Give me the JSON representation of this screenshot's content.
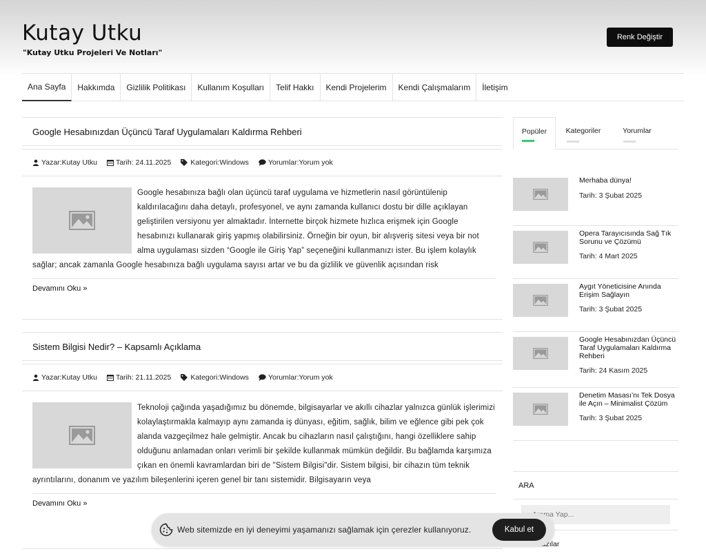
{
  "site": {
    "title": "Kutay Utku",
    "tagline": "\"Kutay Utku Projeleri Ve Notları\"",
    "color_button": "Renk Değiştir"
  },
  "nav": [
    "Ana Sayfa",
    "Hakkımda",
    "Gizlilik Politikası",
    "Kullanım Koşulları",
    "Telif Hakkı",
    "Kendi Projelerim",
    "Kendi Çalışmalarım",
    "İletişim"
  ],
  "posts": [
    {
      "title": "Google Hesabınızdan Üçüncü Taraf Uygulamaları Kaldırma Rehberi",
      "author": "Yazar:Kutay Utku",
      "date": "Tarih: 24.11.2025",
      "category": "Kategori:Windows",
      "comments": "Yorumlar:Yorum yok",
      "excerpt": "Google hesabınıza bağlı olan üçüncü taraf uygulama ve hizmetlerin nasıl görüntülenip kaldırılacağını daha detaylı, profesyonel, ve aynı zamanda kullanıcı dostu bir dille açıklayan geliştirilen versiyonu yer almaktadır. İnternette birçok hizmete hızlıca erişmek için Google hesabınızı kullanarak giriş yapmış olabilirsiniz. Örneğin bir oyun, bir alışveriş sitesi veya bir not alma uygulaması sizden “Google ile Giriş Yap” seçeneğini kullanmanızı ister. Bu işlem kolaylık sağlar; ancak zamanla Google hesabınıza bağlı uygulama sayısı artar ve bu da gizlilik ve güvenlik açısından risk",
      "read_more": "Devamını Oku »"
    },
    {
      "title": "Sistem Bilgisi Nedir? – Kapsamlı Açıklama",
      "author": "Yazar:Kutay Utku",
      "date": "Tarih: 21.11.2025",
      "category": "Kategori:Windows",
      "comments": "Yorumlar:Yorum yok",
      "excerpt": "Teknoloji çağında yaşadığımız bu dönemde, bilgisayarlar ve akıllı cihazlar yalnızca günlük işlerimizi kolaylaştırmakla kalmayıp aynı zamanda iş dünyası, eğitim, sağlık, bilim ve eğlence gibi pek çok alanda vazgeçilmez hale gelmiştir. Ancak bu cihazların nasıl çalıştığını, hangi özelliklere sahip olduğunu anlamadan onları verimli bir şekilde kullanmak mümkün değildir. Bu bağlamda karşımıza çıkan en önemli kavramlardan biri de \"Sistem Bilgisi\"dir. Sistem bilgisi, bir cihazın tüm teknik ayrıntılarını, donanım ve yazılım bileşenlerini içeren genel bir tanı sistemidir. Bilgisayarın veya",
      "read_more": "Devamını Oku »"
    }
  ],
  "sidebar": {
    "tabs": [
      "Popüler",
      "Kategoriler",
      "Yorumlar"
    ],
    "popular": [
      {
        "title": "Merhaba dünya!",
        "date": "Tarih: 3 Şubat 2025"
      },
      {
        "title": "Opera Tarayıcısında Sağ Tık Sorunu ve Çözümü",
        "date": "Tarih: 4 Mart 2025"
      },
      {
        "title": "Aygıt Yöneticisine Anında Erişim Sağlayın",
        "date": "Tarih: 3 Şubat 2025"
      },
      {
        "title": "Google Hesabınızdan Üçüncü Taraf Uygulamaları Kaldırma Rehberi",
        "date": "Tarih: 24 Kasım 2025"
      },
      {
        "title": "Denetim Masası’nı Tek Dosya ile Açın – Minimalist Çözüm",
        "date": "Tarih: 3 Şubat 2025"
      }
    ],
    "search_title": "ARA",
    "search_placeholder": "Arama Yap...",
    "recent_title": "Son Yazılar"
  },
  "cookie": {
    "text": "Web sitemizde en iyi deneyimi yaşamanızı sağlamak için çerezler kullanıyoruz.",
    "accept": "Kabul et"
  },
  "colors": {
    "active_tab_bar": "#2ecc71",
    "button_bg": "#0d0d0d"
  }
}
